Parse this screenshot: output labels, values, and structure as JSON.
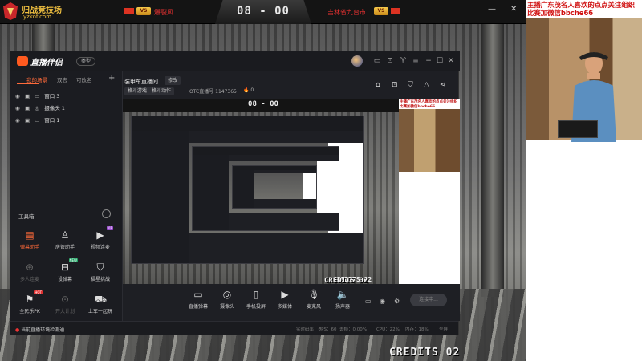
{
  "stream_overlay": {
    "brand_name": "归战竞技场",
    "brand_url": "yzkof.com",
    "player1": "爆裂风",
    "player2": "吉林省九台市",
    "vs_badge": "VS",
    "score": "08 - 00",
    "credits": "CREDITS 02"
  },
  "window_controls": {
    "minimize": "—",
    "maximize": "☐",
    "close": "✕"
  },
  "webcam": {
    "caption": "主播广东茂名人喜欢的点点关注组织比赛加微信bbche66"
  },
  "app": {
    "name": "直播伴侣",
    "type_pill": "类型",
    "sidebar": {
      "tabs": [
        "我的场景",
        "双去",
        "可改名"
      ],
      "add": "+",
      "sources": [
        {
          "label": "窗口 3"
        },
        {
          "label": "摄像头 1"
        },
        {
          "label": "窗口 1"
        }
      ],
      "toolbox_label": "工具箱",
      "toolbox_more": "···",
      "tools": [
        {
          "label": "弹幕助手",
          "icon": "danmaku-helper-icon",
          "accent": true
        },
        {
          "label": "房管助手",
          "icon": "room-manager-icon"
        },
        {
          "label": "视频连麦",
          "icon": "video-link-icon",
          "tag": "VIP"
        },
        {
          "label": "多人连麦",
          "icon": "multi-link-icon",
          "dim": true
        },
        {
          "label": "设弹幕",
          "icon": "set-danmaku-icon",
          "tag": "NEW"
        },
        {
          "label": "福星挑战",
          "icon": "lucky-challenge-icon"
        },
        {
          "label": "全民乐PK",
          "icon": "pk-icon",
          "tag": "HOT"
        },
        {
          "label": "开大计划",
          "icon": "plan-icon",
          "dim": true
        },
        {
          "label": "上车一起玩",
          "icon": "car-icon"
        }
      ]
    },
    "room": {
      "title": "装甲车直播间",
      "edit": "修改",
      "category": "格斗游戏 - 格斗动作",
      "otc_label": "OTC直播号",
      "otc_value": "1147365",
      "hot": "0"
    },
    "controls": [
      {
        "label": "直播弹幕",
        "icon": "danmaku-icon"
      },
      {
        "label": "摄像头",
        "icon": "camera-icon"
      },
      {
        "label": "手机投屏",
        "icon": "phone-cast-icon"
      },
      {
        "label": "多媒体",
        "icon": "media-icon"
      },
      {
        "label": "麦克风",
        "icon": "microphone-icon"
      },
      {
        "label": "扬声器",
        "icon": "speaker-icon"
      }
    ],
    "go_live": "连接中...",
    "status": {
      "warning": "当前直播环境检测通",
      "bitrate": "实时码率：0",
      "fps": "FPS：60",
      "dropped": "丢帧：0.00%",
      "cpu": "CPU：22%",
      "mem": "内存：18%",
      "fullscreen": "全屏"
    },
    "preview_caption": "主播广东茂名人喜欢的点点关注组织比赛加微信bbche66",
    "preview_score": "08 - 00",
    "preview_credits": "CREDITS 02"
  }
}
